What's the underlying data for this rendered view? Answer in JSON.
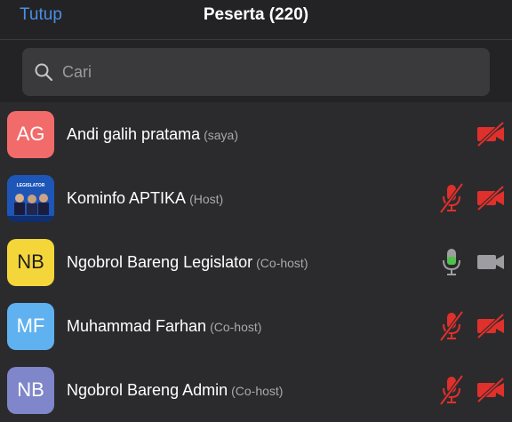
{
  "header": {
    "close_label": "Tutup",
    "title": "Peserta (220)"
  },
  "search": {
    "placeholder": "Cari"
  },
  "participants": [
    {
      "initials": "AG",
      "name": "Andi galih pratama",
      "role": "(saya)",
      "avatar_color": "#f26b6b",
      "mic": "none",
      "camera": "off"
    },
    {
      "initials": "",
      "name": "Kominfo APTIKA",
      "role": "(Host)",
      "avatar_color": "#2563c5",
      "mic": "muted",
      "camera": "off",
      "thumb_text": "LEGISLATOR"
    },
    {
      "initials": "NB",
      "name": "Ngobrol Bareng Legislator",
      "role": "(Co-host)",
      "avatar_color": "#f5d63a",
      "mic": "active",
      "camera": "idle"
    },
    {
      "initials": "MF",
      "name": "Muhammad Farhan",
      "role": "(Co-host)",
      "avatar_color": "#5fb1f0",
      "mic": "muted",
      "camera": "off"
    },
    {
      "initials": "NB",
      "name": "Ngobrol Bareng Admin",
      "role": "(Co-host)",
      "avatar_color": "#7f86c9",
      "mic": "muted",
      "camera": "off"
    }
  ],
  "colors": {
    "accent": "#4a8fe7",
    "muted_red": "#e0302c",
    "mic_active_green": "#4fc24b",
    "icon_gray": "#9e9ea2"
  }
}
